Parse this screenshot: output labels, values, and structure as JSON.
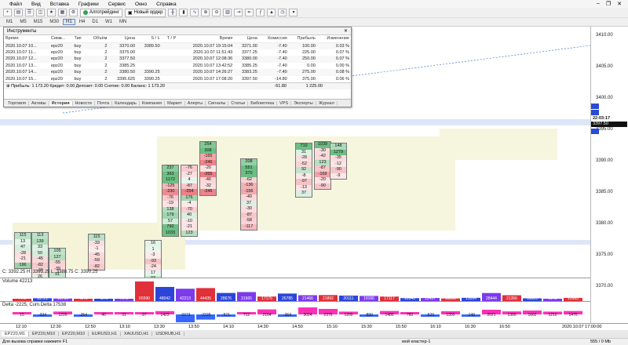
{
  "menu": [
    "Файл",
    "Вид",
    "Вставка",
    "Графики",
    "Сервис",
    "Окно",
    "Справка"
  ],
  "toolbar": {
    "algo_label": "Алготрейдинг",
    "new_order_label": "Новый ордер"
  },
  "timeframes": [
    "M1",
    "M5",
    "M15",
    "M30",
    "H1",
    "H4",
    "D1",
    "W1",
    "MN"
  ],
  "active_tf": "H1",
  "terminal": {
    "title": "Инструменты",
    "columns": [
      "Время",
      "Симв...",
      "Тип",
      "Объём",
      "Цена",
      "S / L",
      "T / P",
      "Время",
      "Цена",
      "Комиссия",
      "Прибыль",
      "Изменение"
    ],
    "rows": [
      [
        "2020.10.07 10...",
        "epz20",
        "buy",
        "2",
        "3370.00",
        "3389.50",
        "",
        "2020.10.07 19:15:04",
        "3371.00",
        "-7.40",
        "100.00",
        "0.03 %"
      ],
      [
        "2020.10.07 11...",
        "epz20",
        "buy",
        "2",
        "3375.00",
        "",
        "",
        "2020.10.07 11:51:43",
        "3377.25",
        "-7.40",
        "225.00",
        "0.07 %"
      ],
      [
        "2020.10.07 12...",
        "epz20",
        "buy",
        "2",
        "3377.50",
        "",
        "",
        "2020.10.07 12:08:36",
        "3380.00",
        "-7.40",
        "250.00",
        "0.07 %"
      ],
      [
        "2020.10.07 13...",
        "epz20",
        "buy",
        "2",
        "3385.25",
        "",
        "",
        "2020.10.07 13:42:52",
        "3385.25",
        "-7.40",
        "0.00",
        "0.00 %"
      ],
      [
        "2020.10.07 14...",
        "epz20",
        "buy",
        "2",
        "3380.50",
        "3390.25",
        "",
        "2020.10.07 14:26:27",
        "3383.25",
        "-7.40",
        "275.00",
        "0.08 %"
      ],
      [
        "2020.10.07 15...",
        "epz20",
        "buy",
        "2",
        "3395.625",
        "3390.25",
        "",
        "2020.10.07 17:08:20",
        "3397.50",
        "-14.80",
        "375.00",
        "0.06 %"
      ]
    ],
    "total_text": "Прибыль: 1 173.20  Кредит: 0.00  Депозит: 0.00  Снятие: 0.00  Баланс: 1 173.20",
    "total_commission": "-51.80",
    "total_profit": "1 225.00",
    "tabs": [
      "Торговля",
      "Активы",
      "История",
      "Новости",
      "Почта",
      "Календарь",
      "Компания",
      "Маркет",
      "Алерты",
      "Сигналы",
      "Статьи",
      "Библиотека",
      "VPS",
      "Эксперты",
      "Журнал"
    ],
    "active_tab": "История"
  },
  "chart": {
    "price_labels": [
      "3410.00",
      "3405.00",
      "3400.00",
      "3395.00",
      "3390.00",
      "3385.00",
      "3380.00",
      "3375.00",
      "3370.00"
    ],
    "price_values": [
      3410,
      3405,
      3400,
      3395,
      3390,
      3385,
      3380,
      3375,
      3370
    ],
    "current_price": "3397.50",
    "time_label": "22:03:17",
    "info_line": "C: 3392.25  H: 3393.25  L: 3388.75  C: 3390.25"
  },
  "volume_panel": {
    "title": "Volume 42213",
    "bars": [
      4472,
      11721,
      10716,
      4541,
      4271,
      7646,
      65590,
      48042,
      42213,
      44435,
      28676,
      31565,
      17175,
      26785,
      21466,
      21892,
      20111,
      19166,
      17117,
      12043,
      12457,
      11056,
      13064,
      28444,
      21356,
      11329,
      6142,
      12863
    ]
  },
  "delta_panel": {
    "title": "Delta -2225, Cum.Delta 17538",
    "bars": [
      15,
      -334,
      1226,
      -254,
      40,
      31,
      87,
      1423,
      -3373,
      -2225,
      -571,
      712,
      2164,
      -364,
      3024,
      2376,
      1200,
      -890,
      1480,
      760,
      -520,
      1355,
      -140,
      2021,
      1300,
      1662,
      1210,
      1470
    ]
  },
  "time_labels": [
    "12:10",
    "12:30",
    "12:50",
    "13:10",
    "13:30",
    "13:50",
    "14:10",
    "14:30",
    "14:50",
    "15:10",
    "15:30",
    "15:50",
    "16:10",
    "16:30",
    "16:50",
    "2020.10.07 17:00:00"
  ],
  "symbol_tabs": [
    "EPZ20,M1",
    "EPZ20,M10",
    "EPZ20,M10",
    "EURUSD,H1",
    "XAUUSD,H1",
    "USDRUB,H1"
  ],
  "status": {
    "left": "Для вызова справки нажмите F1",
    "middle": "мой кластер-1",
    "right": "555 / 0 Mb"
  },
  "colors": {
    "buy": "#2ea44f",
    "sell": "#e0303a",
    "vol_red": "#e0303a",
    "vol_blue": "#2c45d8",
    "vol_purple": "#7c3aed",
    "delta_pink": "#ff2fb8",
    "delta_blue": "#3566ff"
  },
  "clusters": [
    [
      [
        "115",
        ""
      ],
      [
        "13",
        ""
      ],
      [
        "47",
        ""
      ],
      [
        "-28",
        ""
      ],
      [
        "-21",
        ""
      ],
      [
        "196",
        ""
      ]
    ],
    [
      [
        "113",
        ""
      ],
      [
        "139",
        ""
      ],
      [
        "33",
        ""
      ],
      [
        "50",
        ""
      ],
      [
        "-45",
        ""
      ],
      [
        "-82",
        ""
      ],
      [
        "-30",
        ""
      ],
      [
        "26",
        ""
      ]
    ],
    [
      [
        "105",
        ""
      ],
      [
        "127",
        ""
      ],
      [
        "-55",
        ""
      ],
      [
        "-39",
        ""
      ],
      [
        "91",
        ""
      ],
      [
        "8",
        ""
      ],
      [
        "-9",
        ""
      ]
    ],
    [
      [
        "115",
        ""
      ],
      [
        "-33",
        ""
      ],
      [
        "-1",
        ""
      ],
      [
        "-45",
        ""
      ],
      [
        "-59",
        ""
      ],
      [
        "-82",
        ""
      ]
    ],
    [
      [
        "16",
        ""
      ],
      [
        "1",
        ""
      ],
      [
        "-3",
        ""
      ],
      [
        "-93",
        ""
      ],
      [
        "-24",
        ""
      ],
      [
        "17",
        ""
      ],
      [
        "93",
        ""
      ],
      [
        "92",
        ""
      ],
      [
        "3",
        ""
      ],
      [
        "-156",
        ""
      ]
    ],
    [
      [
        "237",
        ""
      ],
      [
        "363",
        ""
      ],
      [
        "1172",
        ""
      ],
      [
        "-125",
        ""
      ],
      [
        "-230",
        ""
      ],
      [
        "-76",
        ""
      ],
      [
        "-19",
        ""
      ],
      [
        "138",
        ""
      ],
      [
        "179",
        ""
      ],
      [
        "57",
        ""
      ],
      [
        "792",
        ""
      ],
      [
        "1033",
        ""
      ]
    ],
    [
      [
        "-76",
        ""
      ],
      [
        "-27",
        ""
      ],
      [
        "4",
        ""
      ],
      [
        "-87",
        ""
      ],
      [
        "-254",
        ""
      ],
      [
        "176",
        ""
      ],
      [
        "-4",
        ""
      ],
      [
        "-70",
        ""
      ],
      [
        "40",
        ""
      ],
      [
        "-10",
        ""
      ],
      [
        "-21",
        ""
      ],
      [
        "123",
        ""
      ]
    ],
    [
      [
        "254",
        ""
      ],
      [
        "308",
        ""
      ],
      [
        "-165",
        ""
      ],
      [
        "-246",
        ""
      ],
      [
        "-20",
        ""
      ],
      [
        "-265",
        ""
      ],
      [
        "-46",
        ""
      ],
      [
        "-32",
        ""
      ],
      [
        "-246",
        ""
      ]
    ],
    [
      [
        "208",
        ""
      ],
      [
        "551",
        ""
      ],
      [
        "370",
        ""
      ],
      [
        "-62",
        ""
      ],
      [
        "-136",
        ""
      ],
      [
        "-156",
        ""
      ],
      [
        "-40",
        ""
      ],
      [
        "37",
        ""
      ],
      [
        "-30",
        ""
      ],
      [
        "-87",
        ""
      ],
      [
        "-58",
        ""
      ],
      [
        "-117",
        ""
      ]
    ],
    [
      [
        "710",
        ""
      ],
      [
        "31",
        ""
      ],
      [
        "-28",
        ""
      ],
      [
        "-52",
        ""
      ],
      [
        "92",
        ""
      ],
      [
        "-8",
        ""
      ],
      [
        "-97",
        ""
      ],
      [
        "-13",
        ""
      ],
      [
        "37",
        ""
      ]
    ],
    [
      [
        "1039",
        ""
      ],
      [
        "-30",
        ""
      ],
      [
        "-42",
        ""
      ],
      [
        "123",
        ""
      ],
      [
        "-87",
        ""
      ],
      [
        "-169",
        ""
      ],
      [
        "-20",
        ""
      ],
      [
        "-90",
        ""
      ]
    ],
    [
      [
        "148",
        ""
      ],
      [
        "1279",
        ""
      ],
      [
        "-35",
        ""
      ],
      [
        "-12",
        ""
      ],
      [
        "-90",
        ""
      ],
      [
        "-9",
        ""
      ]
    ]
  ]
}
